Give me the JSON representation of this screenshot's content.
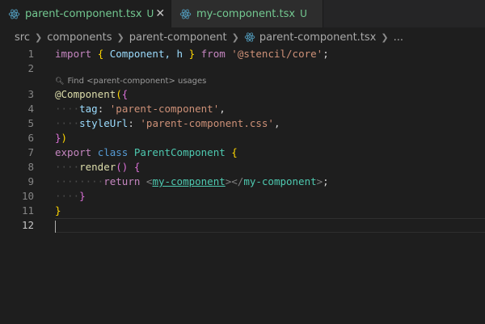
{
  "tabs": [
    {
      "name": "parent-component.tsx",
      "status": "U",
      "close": "✕"
    },
    {
      "name": "my-component.tsx",
      "status": "U"
    }
  ],
  "breadcrumb": [
    "src",
    "components",
    "parent-component",
    "parent-component.tsx",
    "..."
  ],
  "codelens": "Find <parent-component> usages",
  "editor": {
    "line_numbers": [
      "1",
      "2",
      "3",
      "4",
      "5",
      "6",
      "7",
      "8",
      "9",
      "10",
      "11",
      "12"
    ],
    "tokens": {
      "import": "import",
      "from": "from",
      "component_decorator": "@Component",
      "tag_key": "tag",
      "tag_value": "'parent-component'",
      "style_key": "styleUrl",
      "style_value": "'parent-component.css'",
      "export": "export",
      "class_kw": "class",
      "class_name": "ParentComponent",
      "render": "render",
      "return": "return",
      "core_module": "'@stencil/core'",
      "import_names": "Component, h",
      "child_tag": "my-component"
    }
  },
  "colors": {
    "untracked": "#73c991",
    "keyword": "#c586c0",
    "string": "#ce9178",
    "type": "#4ec9b0"
  }
}
